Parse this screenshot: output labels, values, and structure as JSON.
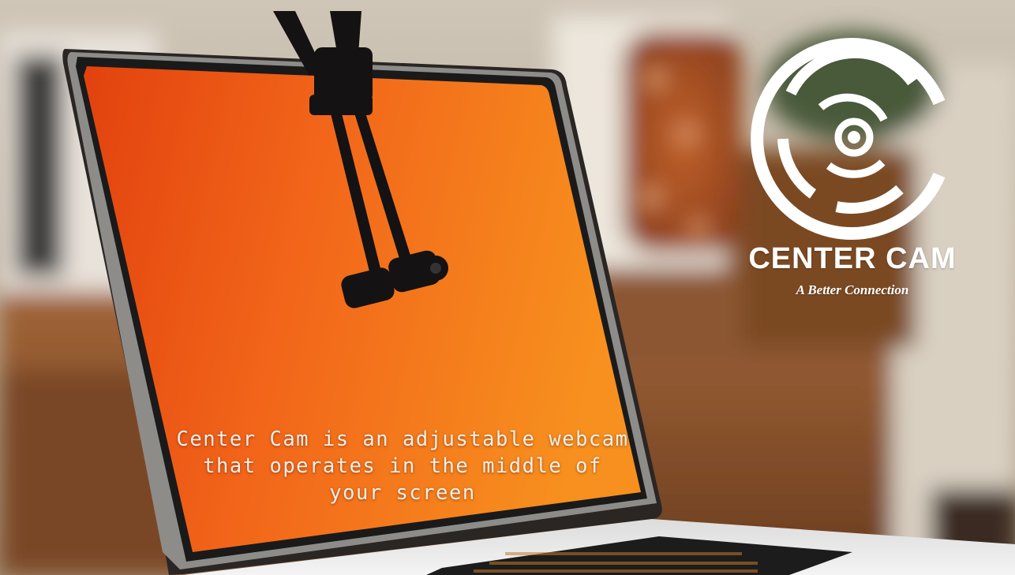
{
  "brand": {
    "name": "Center Cam",
    "name_display": "CENTER CAM",
    "tagline": "A Better Connection"
  },
  "caption": {
    "line1": "Center Cam is an adjustable webcam",
    "line2": "that operates in the middle of",
    "line3": "your screen"
  },
  "colors": {
    "screen_orange": "#f06a14",
    "screen_deep": "#e3460e",
    "logo_white": "#ffffff",
    "background_brown": "#6e4424"
  },
  "icons": [
    "center-cam-logo-icon"
  ]
}
